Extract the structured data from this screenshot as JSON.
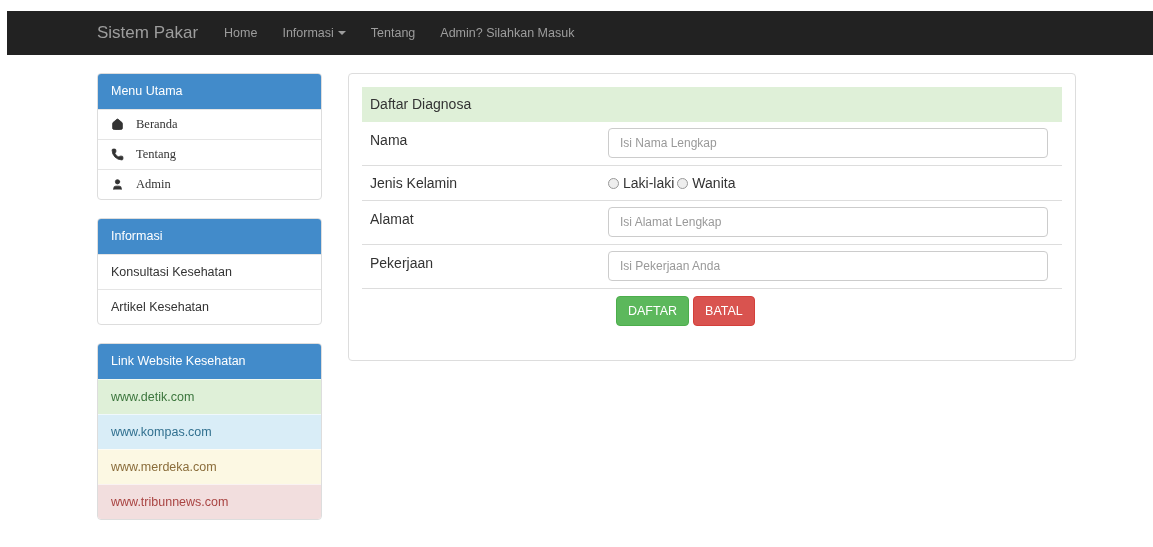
{
  "navbar": {
    "brand": "Sistem Pakar",
    "items": [
      {
        "label": "Home",
        "dropdown": false
      },
      {
        "label": "Informasi",
        "dropdown": true
      },
      {
        "label": "Tentang",
        "dropdown": false
      },
      {
        "label": "Admin? Silahkan Masuk",
        "dropdown": false
      }
    ]
  },
  "sidebar": {
    "panels": [
      {
        "title": "Menu Utama",
        "kind": "icons",
        "items": [
          {
            "label": "Beranda"
          },
          {
            "label": "Tentang"
          },
          {
            "label": "Admin"
          }
        ]
      },
      {
        "title": "Informasi",
        "kind": "plain",
        "items": [
          {
            "label": "Konsultasi Kesehatan"
          },
          {
            "label": "Artikel Kesehatan"
          }
        ]
      },
      {
        "title": "Link Website Kesehatan",
        "kind": "contextual",
        "items": [
          {
            "label": "www.detik.com",
            "kind": "success"
          },
          {
            "label": "www.kompas.com",
            "kind": "info"
          },
          {
            "label": "www.merdeka.com",
            "kind": "warning"
          },
          {
            "label": "www.tribunnews.com",
            "kind": "danger"
          }
        ]
      }
    ]
  },
  "form": {
    "title": "Daftar Diagnosa",
    "rows": [
      {
        "label": "Nama",
        "kind": "text",
        "placeholder": "Isi Nama Lengkap"
      },
      {
        "label": "Jenis Kelamin",
        "kind": "radio",
        "options": [
          {
            "label": "Laki-laki",
            "selected": false
          },
          {
            "label": "Wanita",
            "selected": false
          }
        ]
      },
      {
        "label": "Alamat",
        "kind": "text",
        "placeholder": "Isi Alamat Lengkap"
      },
      {
        "label": "Pekerjaan",
        "kind": "text",
        "placeholder": "Isi Pekerjaan Anda"
      }
    ],
    "buttons": [
      {
        "label": "DAFTAR",
        "kind": "success"
      },
      {
        "label": "BATAL",
        "kind": "danger"
      }
    ]
  }
}
